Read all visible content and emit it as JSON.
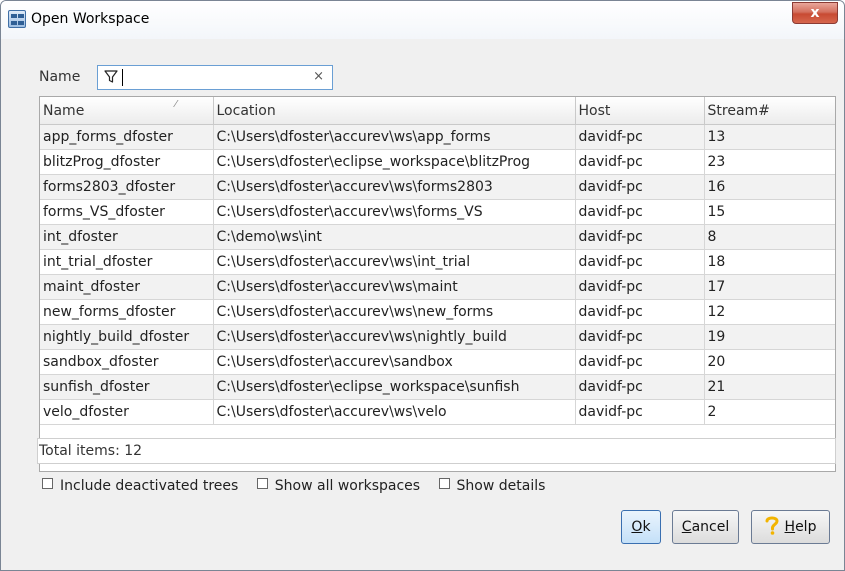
{
  "window": {
    "title": "Open Workspace",
    "close_symbol": "x"
  },
  "filter": {
    "label": "Name",
    "value": "",
    "clear_symbol": "×",
    "icon": "filter-funnel-icon"
  },
  "table": {
    "columns": [
      "Name",
      "Location",
      "Host",
      "Stream#"
    ],
    "sort_indicator": "⁄",
    "rows": [
      {
        "name": "app_forms_dfoster",
        "location": "C:\\Users\\dfoster\\accurev\\ws\\app_forms",
        "host": "davidf-pc",
        "stream": "13"
      },
      {
        "name": "blitzProg_dfoster",
        "location": "C:\\Users\\dfoster\\eclipse_workspace\\blitzProg",
        "host": "davidf-pc",
        "stream": "23"
      },
      {
        "name": "forms2803_dfoster",
        "location": "C:\\Users\\dfoster\\accurev\\ws\\forms2803",
        "host": "davidf-pc",
        "stream": "16"
      },
      {
        "name": "forms_VS_dfoster",
        "location": "C:\\Users\\dfoster\\accurev\\ws\\forms_VS",
        "host": "davidf-pc",
        "stream": "15"
      },
      {
        "name": "int_dfoster",
        "location": "C:\\demo\\ws\\int",
        "host": "davidf-pc",
        "stream": "8"
      },
      {
        "name": "int_trial_dfoster",
        "location": "C:\\Users\\dfoster\\accurev\\ws\\int_trial",
        "host": "davidf-pc",
        "stream": "18"
      },
      {
        "name": "maint_dfoster",
        "location": "C:\\Users\\dfoster\\accurev\\ws\\maint",
        "host": "davidf-pc",
        "stream": "17"
      },
      {
        "name": "new_forms_dfoster",
        "location": "C:\\Users\\dfoster\\accurev\\ws\\new_forms",
        "host": "davidf-pc",
        "stream": "12"
      },
      {
        "name": "nightly_build_dfoster",
        "location": "C:\\Users\\dfoster\\accurev\\ws\\nightly_build",
        "host": "davidf-pc",
        "stream": "19"
      },
      {
        "name": "sandbox_dfoster",
        "location": "C:\\Users\\dfoster\\accurev\\sandbox",
        "host": "davidf-pc",
        "stream": "20"
      },
      {
        "name": "sunfish_dfoster",
        "location": "C:\\Users\\dfoster\\eclipse_workspace\\sunfish",
        "host": "davidf-pc",
        "stream": "21"
      },
      {
        "name": "velo_dfoster",
        "location": "C:\\Users\\dfoster\\accurev\\ws\\velo",
        "host": "davidf-pc",
        "stream": "2"
      }
    ]
  },
  "status": {
    "total_items": "Total items: 12"
  },
  "options": {
    "include_deactivated": {
      "label": "Include deactivated trees",
      "checked": false
    },
    "show_all_workspaces": {
      "label": "Show all workspaces",
      "checked": false
    },
    "show_details": {
      "label": "Show details",
      "checked": false
    }
  },
  "buttons": {
    "ok_mnemonic": "O",
    "ok_rest": "k",
    "cancel_mnemonic": "C",
    "cancel_rest": "ancel",
    "help_mnemonic": "H",
    "help_rest": "elp"
  },
  "colors": {
    "title_close_red": "#c84a33",
    "focus_blue": "#6a9fd4",
    "row_alt": "#f2f2f2"
  }
}
